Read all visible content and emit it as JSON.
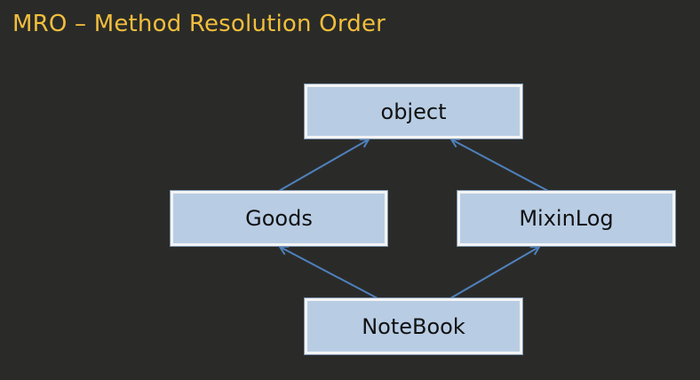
{
  "title": "MRO – Method Resolution Order",
  "nodes": {
    "object": "object",
    "goods": "Goods",
    "mixinlog": "MixinLog",
    "notebook": "NoteBook"
  },
  "edges": [
    {
      "from": "Goods",
      "to": "object"
    },
    {
      "from": "MixinLog",
      "to": "object"
    },
    {
      "from": "NoteBook",
      "to": "Goods"
    },
    {
      "from": "NoteBook",
      "to": "MixinLog"
    }
  ],
  "colors": {
    "background": "#2a2b29",
    "title": "#f2be3c",
    "node_fill": "#b8cde4",
    "arrow": "#4f81bd"
  }
}
